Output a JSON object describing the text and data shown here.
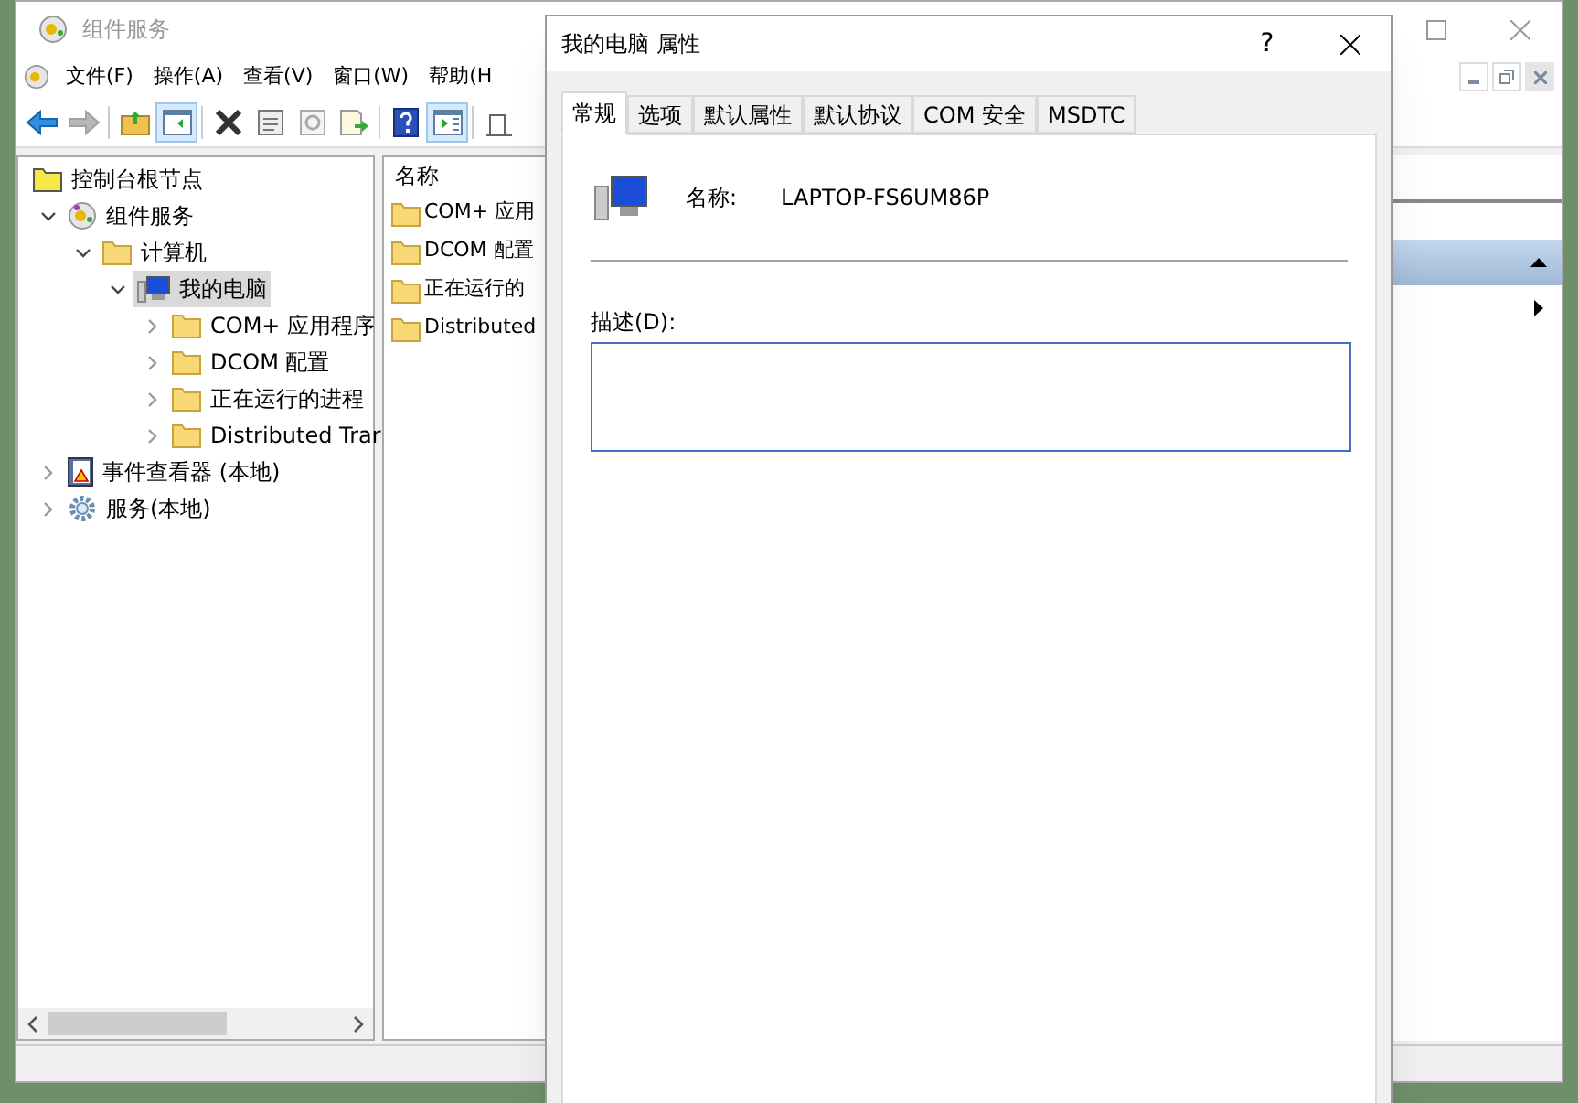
{
  "main_window": {
    "title": "组件服务",
    "active": false
  },
  "menu": [
    "文件(F)",
    "操作(A)",
    "查看(V)",
    "窗口(W)",
    "帮助(H"
  ],
  "toolbar": [
    {
      "kind": "back",
      "disabled": false
    },
    {
      "kind": "forward",
      "disabled": true
    },
    {
      "kind": "sep"
    },
    {
      "kind": "up",
      "selected": false
    },
    {
      "kind": "tree",
      "selected": true
    },
    {
      "kind": "sep"
    },
    {
      "kind": "delete",
      "selected": false
    },
    {
      "kind": "properties",
      "selected": false
    },
    {
      "kind": "refresh",
      "selected": false
    },
    {
      "kind": "export",
      "selected": false
    },
    {
      "kind": "sep"
    },
    {
      "kind": "help",
      "selected": false
    },
    {
      "kind": "action",
      "selected": true
    },
    {
      "kind": "sep"
    },
    {
      "kind": "new",
      "selected": false
    }
  ],
  "tree": [
    {
      "label": "控制台根节点",
      "kind": "root",
      "selected": false,
      "children": [
        {
          "label": "组件服务",
          "kind": "component",
          "expanded": true,
          "selected": false,
          "children": [
            {
              "label": "计算机",
              "kind": "folder",
              "expanded": true,
              "selected": false,
              "children": [
                {
                  "label": "我的电脑",
                  "kind": "computer",
                  "expanded": true,
                  "selected": true,
                  "children": [
                    {
                      "label": "COM+ 应用程序",
                      "kind": "folder",
                      "expanded": false,
                      "selected": false
                    },
                    {
                      "label": "DCOM 配置",
                      "kind": "folder",
                      "expanded": false,
                      "selected": false
                    },
                    {
                      "label": "正在运行的进程",
                      "kind": "folder",
                      "expanded": false,
                      "selected": false
                    },
                    {
                      "label": "Distributed Trar",
                      "kind": "folder",
                      "expanded": false,
                      "selected": false
                    }
                  ]
                }
              ]
            }
          ]
        },
        {
          "label": "事件查看器 (本地)",
          "kind": "events",
          "expanded": false,
          "selected": false
        },
        {
          "label": "服务(本地)",
          "kind": "services",
          "expanded": false,
          "selected": false
        }
      ]
    }
  ],
  "list": {
    "header": "名称",
    "items": [
      "COM+ 应用",
      "DCOM 配置",
      "正在运行的",
      "Distributed"
    ]
  },
  "dialog": {
    "title": "我的电脑 属性",
    "tabs": [
      {
        "label": "常规",
        "selected": true
      },
      {
        "label": "选项",
        "selected": false
      },
      {
        "label": "默认属性",
        "selected": false
      },
      {
        "label": "默认协议",
        "selected": false
      },
      {
        "label": "COM 安全",
        "selected": false
      },
      {
        "label": "MSDTC",
        "selected": false
      }
    ],
    "name_label": "名称:",
    "name_value": "LAPTOP-FS6UM86P",
    "description_label": "描述(D):",
    "help_button": "?"
  }
}
